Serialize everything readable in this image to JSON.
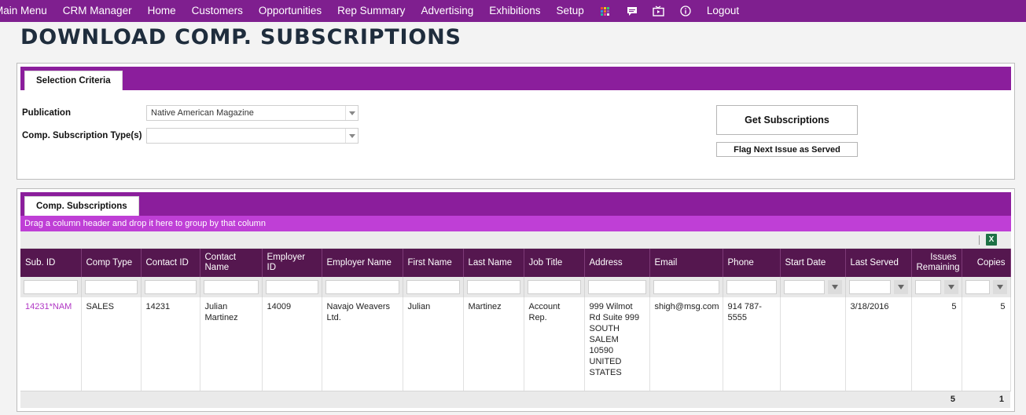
{
  "nav": {
    "items": [
      "Main Menu",
      "CRM Manager",
      "Home",
      "Customers",
      "Opportunities",
      "Rep Summary",
      "Advertising",
      "Exhibitions",
      "Setup"
    ],
    "logout": "Logout",
    "icons": [
      "apps-grid-icon",
      "chat-icon",
      "video-icon",
      "info-icon"
    ]
  },
  "page": {
    "title": "DOWNLOAD COMP. SUBSCRIPTIONS"
  },
  "criteria": {
    "tab": "Selection Criteria",
    "publication_label": "Publication",
    "publication_value": "Native American Magazine",
    "type_label": "Comp. Subscription Type(s)",
    "type_value": "",
    "get_button": "Get Subscriptions",
    "flag_button": "Flag Next Issue as Served"
  },
  "grid": {
    "tab": "Comp. Subscriptions",
    "group_hint": "Drag a column header and drop it here to group by that column",
    "columns": [
      "Sub. ID",
      "Comp Type",
      "Contact ID",
      "Contact Name",
      "Employer ID",
      "Employer Name",
      "First Name",
      "Last Name",
      "Job Title",
      "Address",
      "Email",
      "Phone",
      "Start Date",
      "Last Served",
      "Issues Remaining",
      "Copies"
    ],
    "rows": [
      {
        "sub_id": "14231*NAM",
        "comp_type": "SALES",
        "contact_id": "14231",
        "contact_name": "Julian Martinez",
        "employer_id": "14009",
        "employer_name": "Navajo Weavers Ltd.",
        "first_name": "Julian",
        "last_name": "Martinez",
        "job_title": "Account Rep.",
        "address": "999 Wilmot Rd Suite 999 SOUTH SALEM 10590 UNITED STATES",
        "email": "shigh@msg.com",
        "phone": "914 787-5555",
        "start_date": "",
        "last_served": "3/18/2016",
        "issues_remaining": "5",
        "copies": "5"
      }
    ],
    "totals": {
      "issues_remaining": "5",
      "copies": "1"
    }
  },
  "colors": {
    "nav": "#7f1f8f",
    "panel_header": "#8b1e9c",
    "group_bar": "#bf3fd6",
    "grid_header": "#55174f",
    "link": "#b036c4"
  }
}
